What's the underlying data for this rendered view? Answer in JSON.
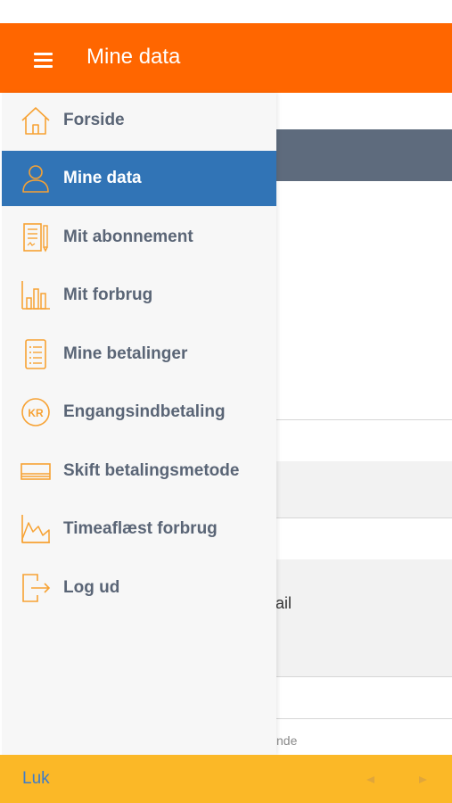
{
  "header": {
    "title": "Mine data",
    "menu_icon": "hamburger-menu-icon",
    "background_color": "#ff6600"
  },
  "drawer": {
    "accent_color": "#f7a233",
    "active_color": "#3174b6",
    "items": [
      {
        "label": "Forside",
        "icon": "home-icon",
        "active": false
      },
      {
        "label": "Mine data",
        "icon": "person-icon",
        "active": true
      },
      {
        "label": "Mit abonnement",
        "icon": "contract-icon",
        "active": false
      },
      {
        "label": "Mit forbrug",
        "icon": "bar-chart-icon",
        "active": false
      },
      {
        "label": "Mine betalinger",
        "icon": "list-icon",
        "active": false
      },
      {
        "label": "Engangsindbetaling",
        "icon": "kr-coin-icon",
        "active": false
      },
      {
        "label": "Skift betalingsmetode",
        "icon": "card-icon",
        "active": false
      },
      {
        "label": "Timeaflæst forbrug",
        "icon": "line-chart-icon",
        "active": false
      },
      {
        "label": "Log ud",
        "icon": "logout-icon",
        "active": false
      }
    ]
  },
  "background_page": {
    "partial_label": "ail",
    "partial_hint": "nde"
  },
  "toolbar": {
    "close_label": "Luk",
    "prev_icon": "arrow-left-icon",
    "next_icon": "arrow-right-icon",
    "background_color": "#fbb827"
  }
}
